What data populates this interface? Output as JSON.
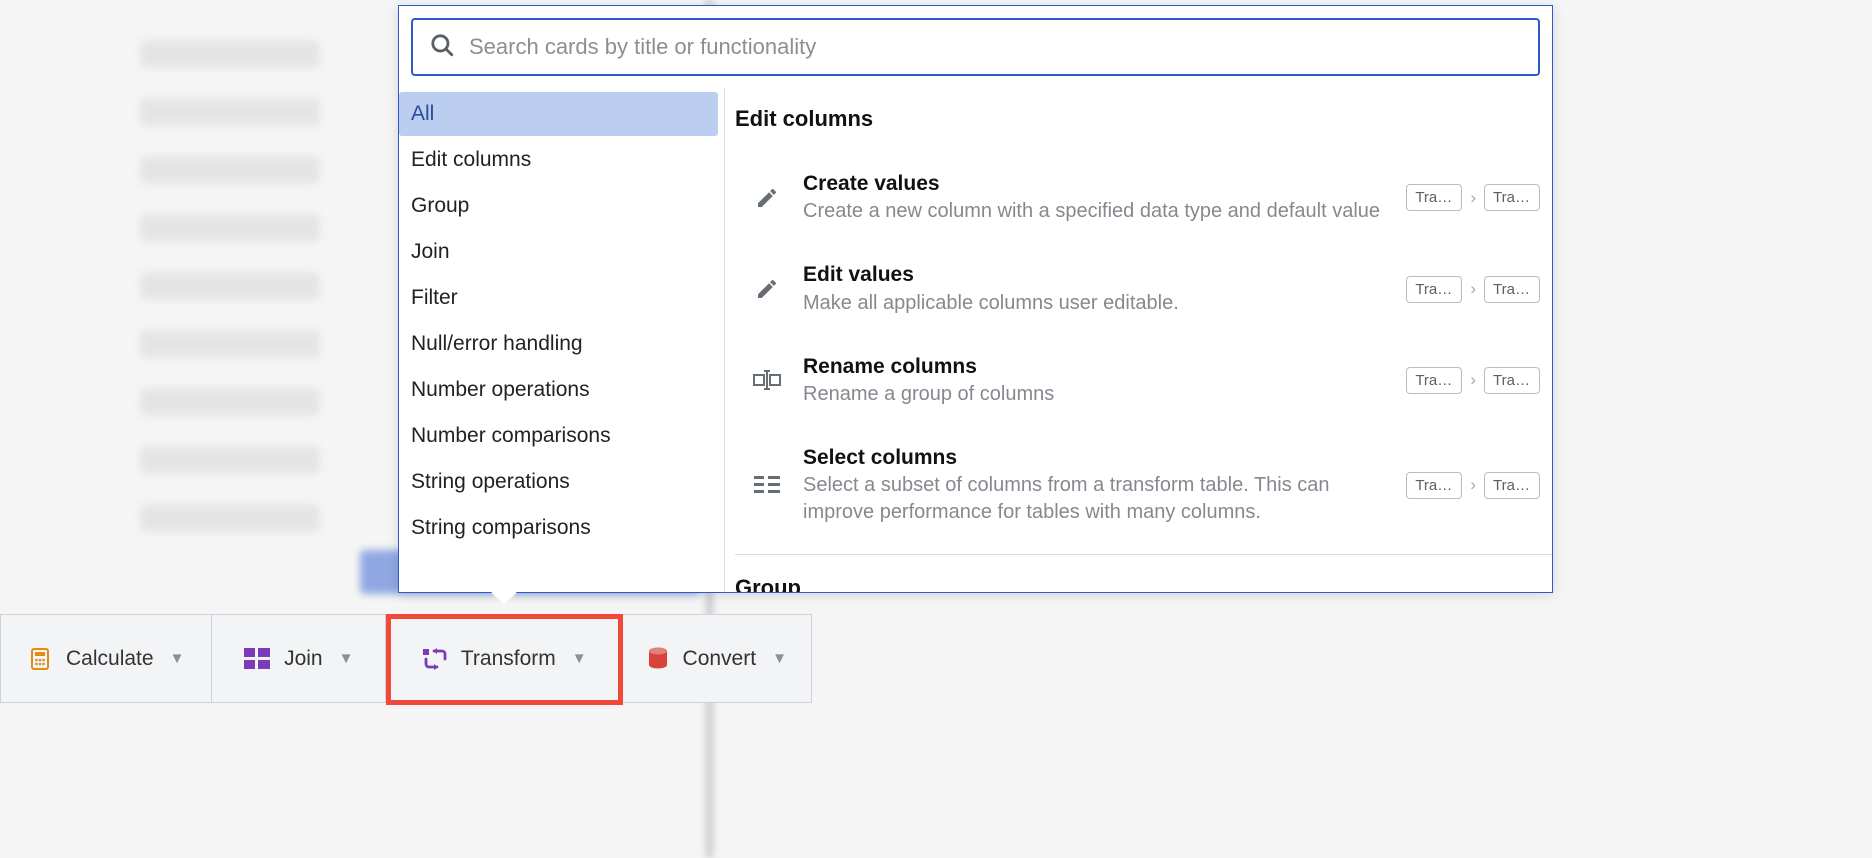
{
  "search": {
    "placeholder": "Search cards by title or functionality"
  },
  "categories": [
    {
      "label": "All",
      "selected": true
    },
    {
      "label": "Edit columns",
      "selected": false
    },
    {
      "label": "Group",
      "selected": false
    },
    {
      "label": "Join",
      "selected": false
    },
    {
      "label": "Filter",
      "selected": false
    },
    {
      "label": "Null/error handling",
      "selected": false
    },
    {
      "label": "Number operations",
      "selected": false
    },
    {
      "label": "Number comparisons",
      "selected": false
    },
    {
      "label": "String operations",
      "selected": false
    },
    {
      "label": "String comparisons",
      "selected": false
    }
  ],
  "sections": [
    {
      "title": "Edit columns",
      "cards": [
        {
          "icon": "pencil-icon",
          "title": "Create values",
          "desc": "Create a new column with a specified data type and default value",
          "tags": [
            "Transf…",
            "Transf…"
          ]
        },
        {
          "icon": "pencil-icon",
          "title": "Edit values",
          "desc": "Make all applicable columns user editable.",
          "tags": [
            "Transf…",
            "Transf…"
          ]
        },
        {
          "icon": "rename-icon",
          "title": "Rename columns",
          "desc": "Rename a group of columns",
          "tags": [
            "Transf…",
            "Transf…"
          ]
        },
        {
          "icon": "columns-icon",
          "title": "Select columns",
          "desc": "Select a subset of columns from a transform table. This can improve performance for tables with many columns.",
          "tags": [
            "Transf…",
            "Transf…"
          ]
        }
      ]
    },
    {
      "title": "Group",
      "cards": []
    }
  ],
  "toolbar": [
    {
      "icon": "calculator-icon",
      "color": "#e08b12",
      "label": "Calculate"
    },
    {
      "icon": "grid-icon",
      "color": "#7d3ab8",
      "label": "Join"
    },
    {
      "icon": "transform-icon",
      "color": "#7d3ab8",
      "label": "Transform"
    },
    {
      "icon": "database-icon",
      "color": "#d9433b",
      "label": "Convert"
    }
  ]
}
